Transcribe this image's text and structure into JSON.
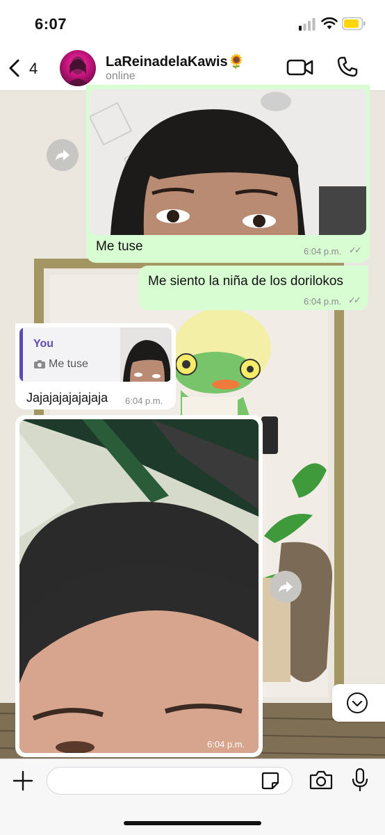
{
  "status_bar": {
    "time": "6:07"
  },
  "header": {
    "back_count": "4",
    "contact_name": "LaReinadelaKawis🌻",
    "contact_status": "online"
  },
  "messages": {
    "m1": {
      "caption": "Me tuse",
      "time": "6:04 p.m."
    },
    "m2": {
      "text": "Me siento la niña de los dorilokos",
      "time": "6:04 p.m."
    },
    "m3": {
      "reply_author": "You",
      "reply_text": "Me tuse",
      "text": "Jajajajajajajaja",
      "time": "6:04 p.m."
    },
    "m4": {
      "time": "6:04 p.m."
    }
  },
  "colors": {
    "outgoing_bubble": "#d9fdd3",
    "reply_accent": "#5a4bb0",
    "reply_author": "#5e4bb0"
  },
  "icons": [
    "back-icon",
    "video-call-icon",
    "phone-icon",
    "forward-icon",
    "scroll-down-icon",
    "plus-icon",
    "sticker-icon",
    "camera-icon",
    "microphone-icon"
  ]
}
